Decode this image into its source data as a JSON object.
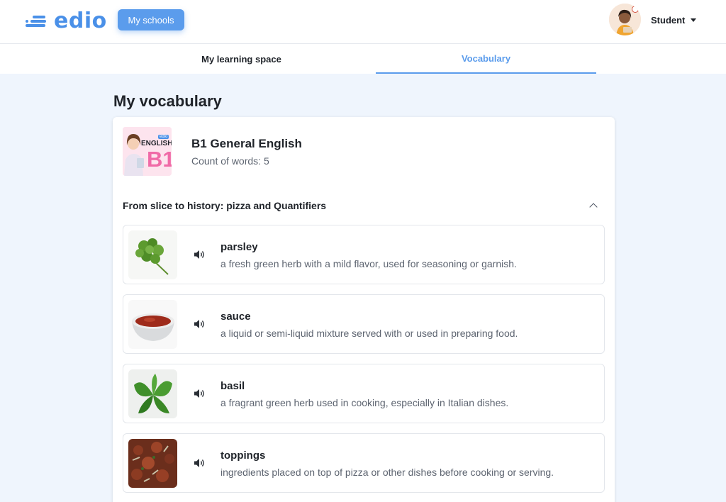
{
  "header": {
    "logo_text": "edio",
    "my_schools_label": "My schools",
    "user_label": "Student"
  },
  "tabs": [
    {
      "label": "My learning space",
      "active": false
    },
    {
      "label": "Vocabulary",
      "active": true
    }
  ],
  "page": {
    "title": "My vocabulary"
  },
  "course": {
    "title": "B1 General English",
    "count_label": "Count of words: 5",
    "thumb_brand": "edio",
    "thumb_subject": "ENGLISH",
    "thumb_level": "B1"
  },
  "section": {
    "title": "From slice to history: pizza and Quantifiers",
    "expanded": true
  },
  "words": [
    {
      "term": "parsley",
      "definition": "a fresh green herb with a mild flavor, used for seasoning or garnish.",
      "image": "parsley-image"
    },
    {
      "term": "sauce",
      "definition": "a liquid or semi-liquid mixture served with or used in preparing food.",
      "image": "sauce-bowl-image"
    },
    {
      "term": "basil",
      "definition": "a fragrant green herb used in cooking, especially in Italian dishes.",
      "image": "basil-image"
    },
    {
      "term": "toppings",
      "definition": "ingredients placed on top of pizza or other dishes before cooking or serving.",
      "image": "pizza-toppings-image"
    }
  ],
  "colors": {
    "accent": "#5b9cec",
    "brand": "#4a90e8",
    "page_bg": "#eff5fd",
    "text_primary": "#1f2329",
    "text_secondary": "#5d6470"
  }
}
